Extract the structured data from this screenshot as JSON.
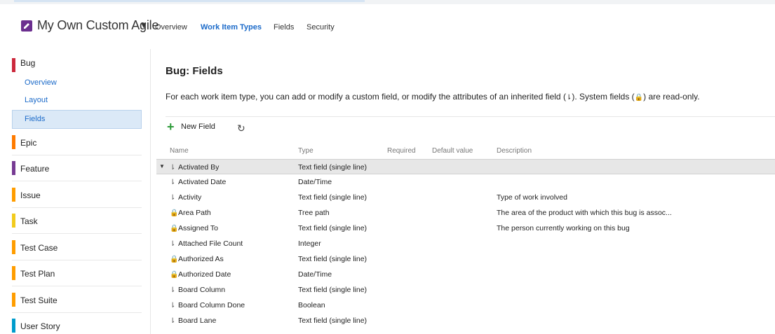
{
  "header": {
    "process_name": "My Own Custom Agile",
    "nav": [
      {
        "label": "Overview",
        "active": false
      },
      {
        "label": "Work Item Types",
        "active": true
      },
      {
        "label": "Fields",
        "active": false
      },
      {
        "label": "Security",
        "active": false
      }
    ]
  },
  "sidebar": {
    "bug": {
      "label": "Bug",
      "color": "#cc293d"
    },
    "bug_subs": [
      "Overview",
      "Layout",
      "Fields"
    ],
    "items": [
      {
        "label": "Epic",
        "color": "#ff7b00"
      },
      {
        "label": "Feature",
        "color": "#773b93"
      },
      {
        "label": "Issue",
        "color": "#ff9d00"
      },
      {
        "label": "Task",
        "color": "#f2cb1d"
      },
      {
        "label": "Test Case",
        "color": "#ff9d00"
      },
      {
        "label": "Test Plan",
        "color": "#ff9d00"
      },
      {
        "label": "Test Suite",
        "color": "#ff9d00"
      },
      {
        "label": "User Story",
        "color": "#009ccc"
      }
    ]
  },
  "main": {
    "title": "Bug: Fields",
    "description_part1": "For each work item type, you can add or modify a custom field, or modify the attributes of an inherited field (",
    "description_part2": "). System fields (",
    "description_part3": ") are read-only.",
    "inherited_glyph": "⇂",
    "lock_glyph": "🔒",
    "toolbar": {
      "new_field": "New Field",
      "refresh_icon": "refresh-icon"
    }
  },
  "table": {
    "headers": [
      "Name",
      "Type",
      "Required",
      "Default value",
      "Description"
    ],
    "rows": [
      {
        "icon": "inherited",
        "name": "Activated By",
        "type": "Text field (single line)",
        "description": "",
        "selected": true
      },
      {
        "icon": "inherited",
        "name": "Activated Date",
        "type": "Date/Time",
        "description": ""
      },
      {
        "icon": "inherited",
        "name": "Activity",
        "type": "Text field (single line)",
        "description": "Type of work involved"
      },
      {
        "icon": "lock",
        "name": "Area Path",
        "type": "Tree path",
        "description": "The area of the product with which this bug is assoc..."
      },
      {
        "icon": "lock",
        "name": "Assigned To",
        "type": "Text field (single line)",
        "description": "The person currently working on this bug"
      },
      {
        "icon": "inherited",
        "name": "Attached File Count",
        "type": "Integer",
        "description": ""
      },
      {
        "icon": "lock",
        "name": "Authorized As",
        "type": "Text field (single line)",
        "description": ""
      },
      {
        "icon": "lock",
        "name": "Authorized Date",
        "type": "Date/Time",
        "description": ""
      },
      {
        "icon": "inherited",
        "name": "Board Column",
        "type": "Text field (single line)",
        "description": ""
      },
      {
        "icon": "inherited",
        "name": "Board Column Done",
        "type": "Boolean",
        "description": ""
      },
      {
        "icon": "inherited",
        "name": "Board Lane",
        "type": "Text field (single line)",
        "description": ""
      }
    ]
  }
}
